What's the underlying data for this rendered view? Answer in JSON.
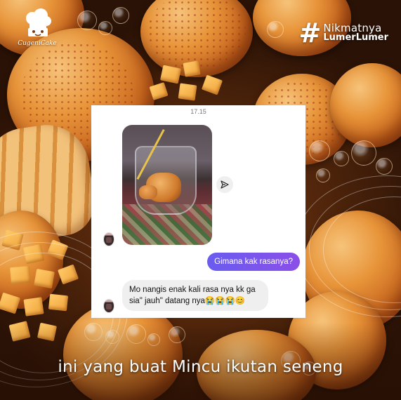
{
  "brand": {
    "logo_text": "CugeniCake"
  },
  "hashtag": {
    "mark": "#",
    "line1": "Nikmatnya",
    "line2": "LumerLumer"
  },
  "chat": {
    "timestamp": "17.15",
    "sent_message": "Gimana kak rasanya?",
    "received_message": "Mo nangis enak kali rasa nya kk ga sia\" jauh\" datang nya😭😭😭😊",
    "share_icon": "send-icon"
  },
  "caption": "ini yang buat Mincu ikutan seneng",
  "colors": {
    "sent_bubble_start": "#6a5cf0",
    "sent_bubble_end": "#8a4fe8",
    "received_bubble": "#efefef",
    "card_bg": "#ffffff"
  }
}
